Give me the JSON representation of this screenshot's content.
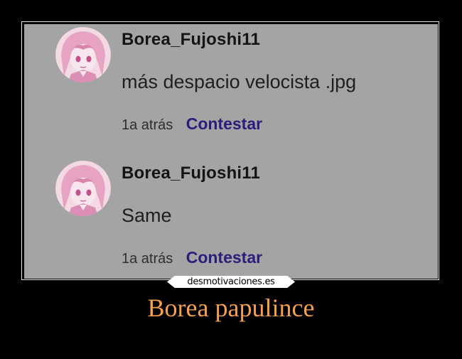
{
  "comments": [
    {
      "avatar_icon": "anime-avatar-icon",
      "username": "Borea_Fujoshi11",
      "text": "más despacio velocista .jpg",
      "time": "1a atrás",
      "reply_label": "Contestar"
    },
    {
      "avatar_icon": "anime-avatar-icon",
      "username": "Borea_Fujoshi11",
      "text": "Same",
      "time": "1a atrás",
      "reply_label": "Contestar"
    }
  ],
  "watermark": "desmotivaciones.es",
  "caption": "Borea papulince",
  "colors": {
    "background": "#000000",
    "panel": "#a4a4a4",
    "reply_link": "#2a1e7c",
    "caption": "#f5a04a",
    "avatar_tint": "#e8a0c0"
  }
}
